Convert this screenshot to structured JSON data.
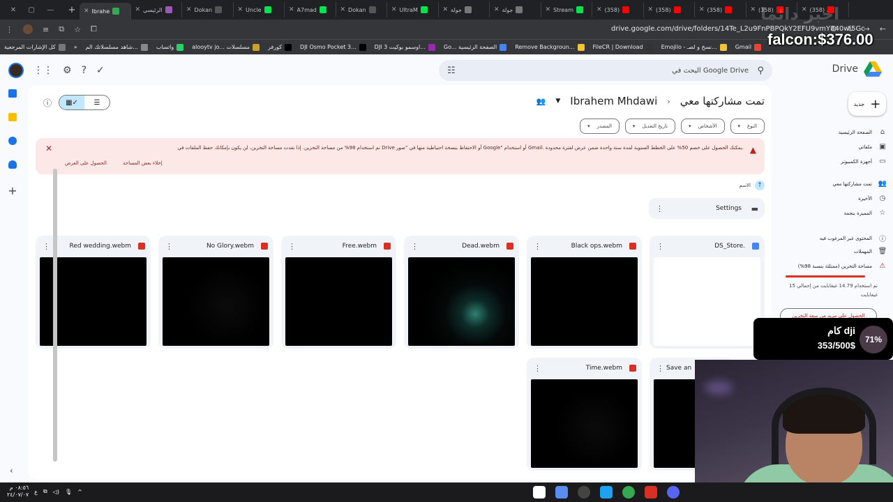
{
  "browser": {
    "tabs": [
      {
        "label": "Ibrahe",
        "active": true,
        "color": "#34a853"
      },
      {
        "label": "الرئيسي",
        "color": "#9b59b6"
      },
      {
        "label": "Dokan",
        "color": "#555"
      },
      {
        "label": "Uncle",
        "color": "#00e54b"
      },
      {
        "label": "A7mad",
        "color": "#00e54b"
      },
      {
        "label": "Dokan",
        "color": "#555"
      },
      {
        "label": "UltraM",
        "color": "#00e54b"
      },
      {
        "label": "جولة",
        "color": "#777"
      },
      {
        "label": "جولة",
        "color": "#777"
      },
      {
        "label": "Stream",
        "color": "#00e54b"
      },
      {
        "label": "(358)",
        "color": "#ff0000"
      },
      {
        "label": "(358)",
        "color": "#ff0000"
      },
      {
        "label": "(358)",
        "color": "#ff0000"
      },
      {
        "label": "(358)",
        "color": "#ff0000"
      },
      {
        "label": "(358)",
        "color": "#ff0000"
      }
    ],
    "url": "drive.google.com/drive/folders/14Te_L2u9FnPBPQkY2EFU9vmY840wi5Gc",
    "bookmarks": [
      {
        "label": "كل الإشارات المرجعية",
        "color": "#777"
      },
      {
        "label": "شاهد مسلسلاتك الم...",
        "color": "#888"
      },
      {
        "label": "واتساب",
        "color": "#25d366"
      },
      {
        "label": "alooytv jo... مسلسلات",
        "color": "#c9a227"
      },
      {
        "label": "كورفر",
        "color": "#000"
      },
      {
        "label": "DJI Osmo Pocket 3...",
        "color": "#000"
      },
      {
        "label": "DJI اوسمو بوكيت 3...",
        "color": "#9c27b0"
      },
      {
        "label": "Go... الصفحة الرئيسية",
        "color": "#4285f4"
      },
      {
        "label": "Remove Backgroun...",
        "color": "#f4c430"
      },
      {
        "label": "FileCR | Download",
        "color": "#333"
      },
      {
        "label": "Emojilo - نسخ و لصـ...",
        "color": "#f4c430"
      },
      {
        "label": "Gmail",
        "color": "#ea4335"
      }
    ]
  },
  "overlay": {
    "falcon": "falcon:$376.00",
    "watermark": "اخبر دائما",
    "dji_title": "كام dji",
    "dji_progress_text": "353/500$",
    "dji_percent": "71%"
  },
  "drive": {
    "app_name": "Drive",
    "search_placeholder": "البحث في Google Drive",
    "new_button": "جديد",
    "breadcrumb": {
      "parent": "تمت مشاركتها معي",
      "current": "Ibrahem Mhdawi"
    },
    "filters": [
      "النوع",
      "الأشخاص",
      "تاريخ التعديل",
      "المصدر"
    ],
    "banner": {
      "message": "تم استخدام 98% من مساحة التخزين. إذا نفدت مساحة التخزين، لن يكون بإمكانك حفظ الملفات في Drive أو الاحتفاظ بنسخة احتياطية منها في \"صور Google\" أو استخدام Gmail. يمكنك الحصول على خصم 50% على الخطط السنوية لمدة سنة واحدة ضمن عرض لفترة محدودة.",
      "action_free": "إخلاء بعض المساحة",
      "action_offer": "الحصول على العرض"
    },
    "sort_label": "الاسم",
    "folder": {
      "name": "Settings"
    },
    "files": [
      {
        "name": "Red wedding.webm",
        "type": "video"
      },
      {
        "name": "No Glory.webm",
        "type": "video"
      },
      {
        "name": "Free.webm",
        "type": "video"
      },
      {
        "name": "Dead.webm",
        "type": "video"
      },
      {
        "name": "Black ops.webm",
        "type": "video"
      },
      {
        "name": "DS_Store.",
        "type": "doc"
      },
      {
        "name": "Time.webm",
        "type": "video"
      },
      {
        "name": "Save an",
        "type": "video"
      }
    ],
    "nav": [
      {
        "label": "الصفحة الرئيسية",
        "icon": "home-icon"
      },
      {
        "label": "ملفاتي",
        "icon": "my-drive-icon"
      },
      {
        "label": "أجهزة الكمبيوتر",
        "icon": "computer-icon"
      },
      {
        "label": "تمت مشاركتها معي",
        "icon": "shared-icon"
      },
      {
        "label": "الأخيرة",
        "icon": "clock-icon"
      },
      {
        "label": "المميزة بنجمة",
        "icon": "star-icon"
      },
      {
        "label": "المحتوى غير المرغوب فيه",
        "icon": "spam-icon"
      },
      {
        "label": "المهملات",
        "icon": "trash-icon"
      },
      {
        "label": "مساحة التخزين (ممتلئة بنسبة 98%)",
        "icon": "warning-icon"
      }
    ],
    "storage_text": "تم استخدام 14.79 غيغابايت من إجمالي 15 غيغابايت",
    "storage_fraction": 0.98,
    "more_storage_button": "الحصول على مزيد من سعة التخزين"
  },
  "taskbar": {
    "time": "٠٨:٥٦ م",
    "date": "٢٤/٠٧/٠٧",
    "lang": "ع"
  }
}
